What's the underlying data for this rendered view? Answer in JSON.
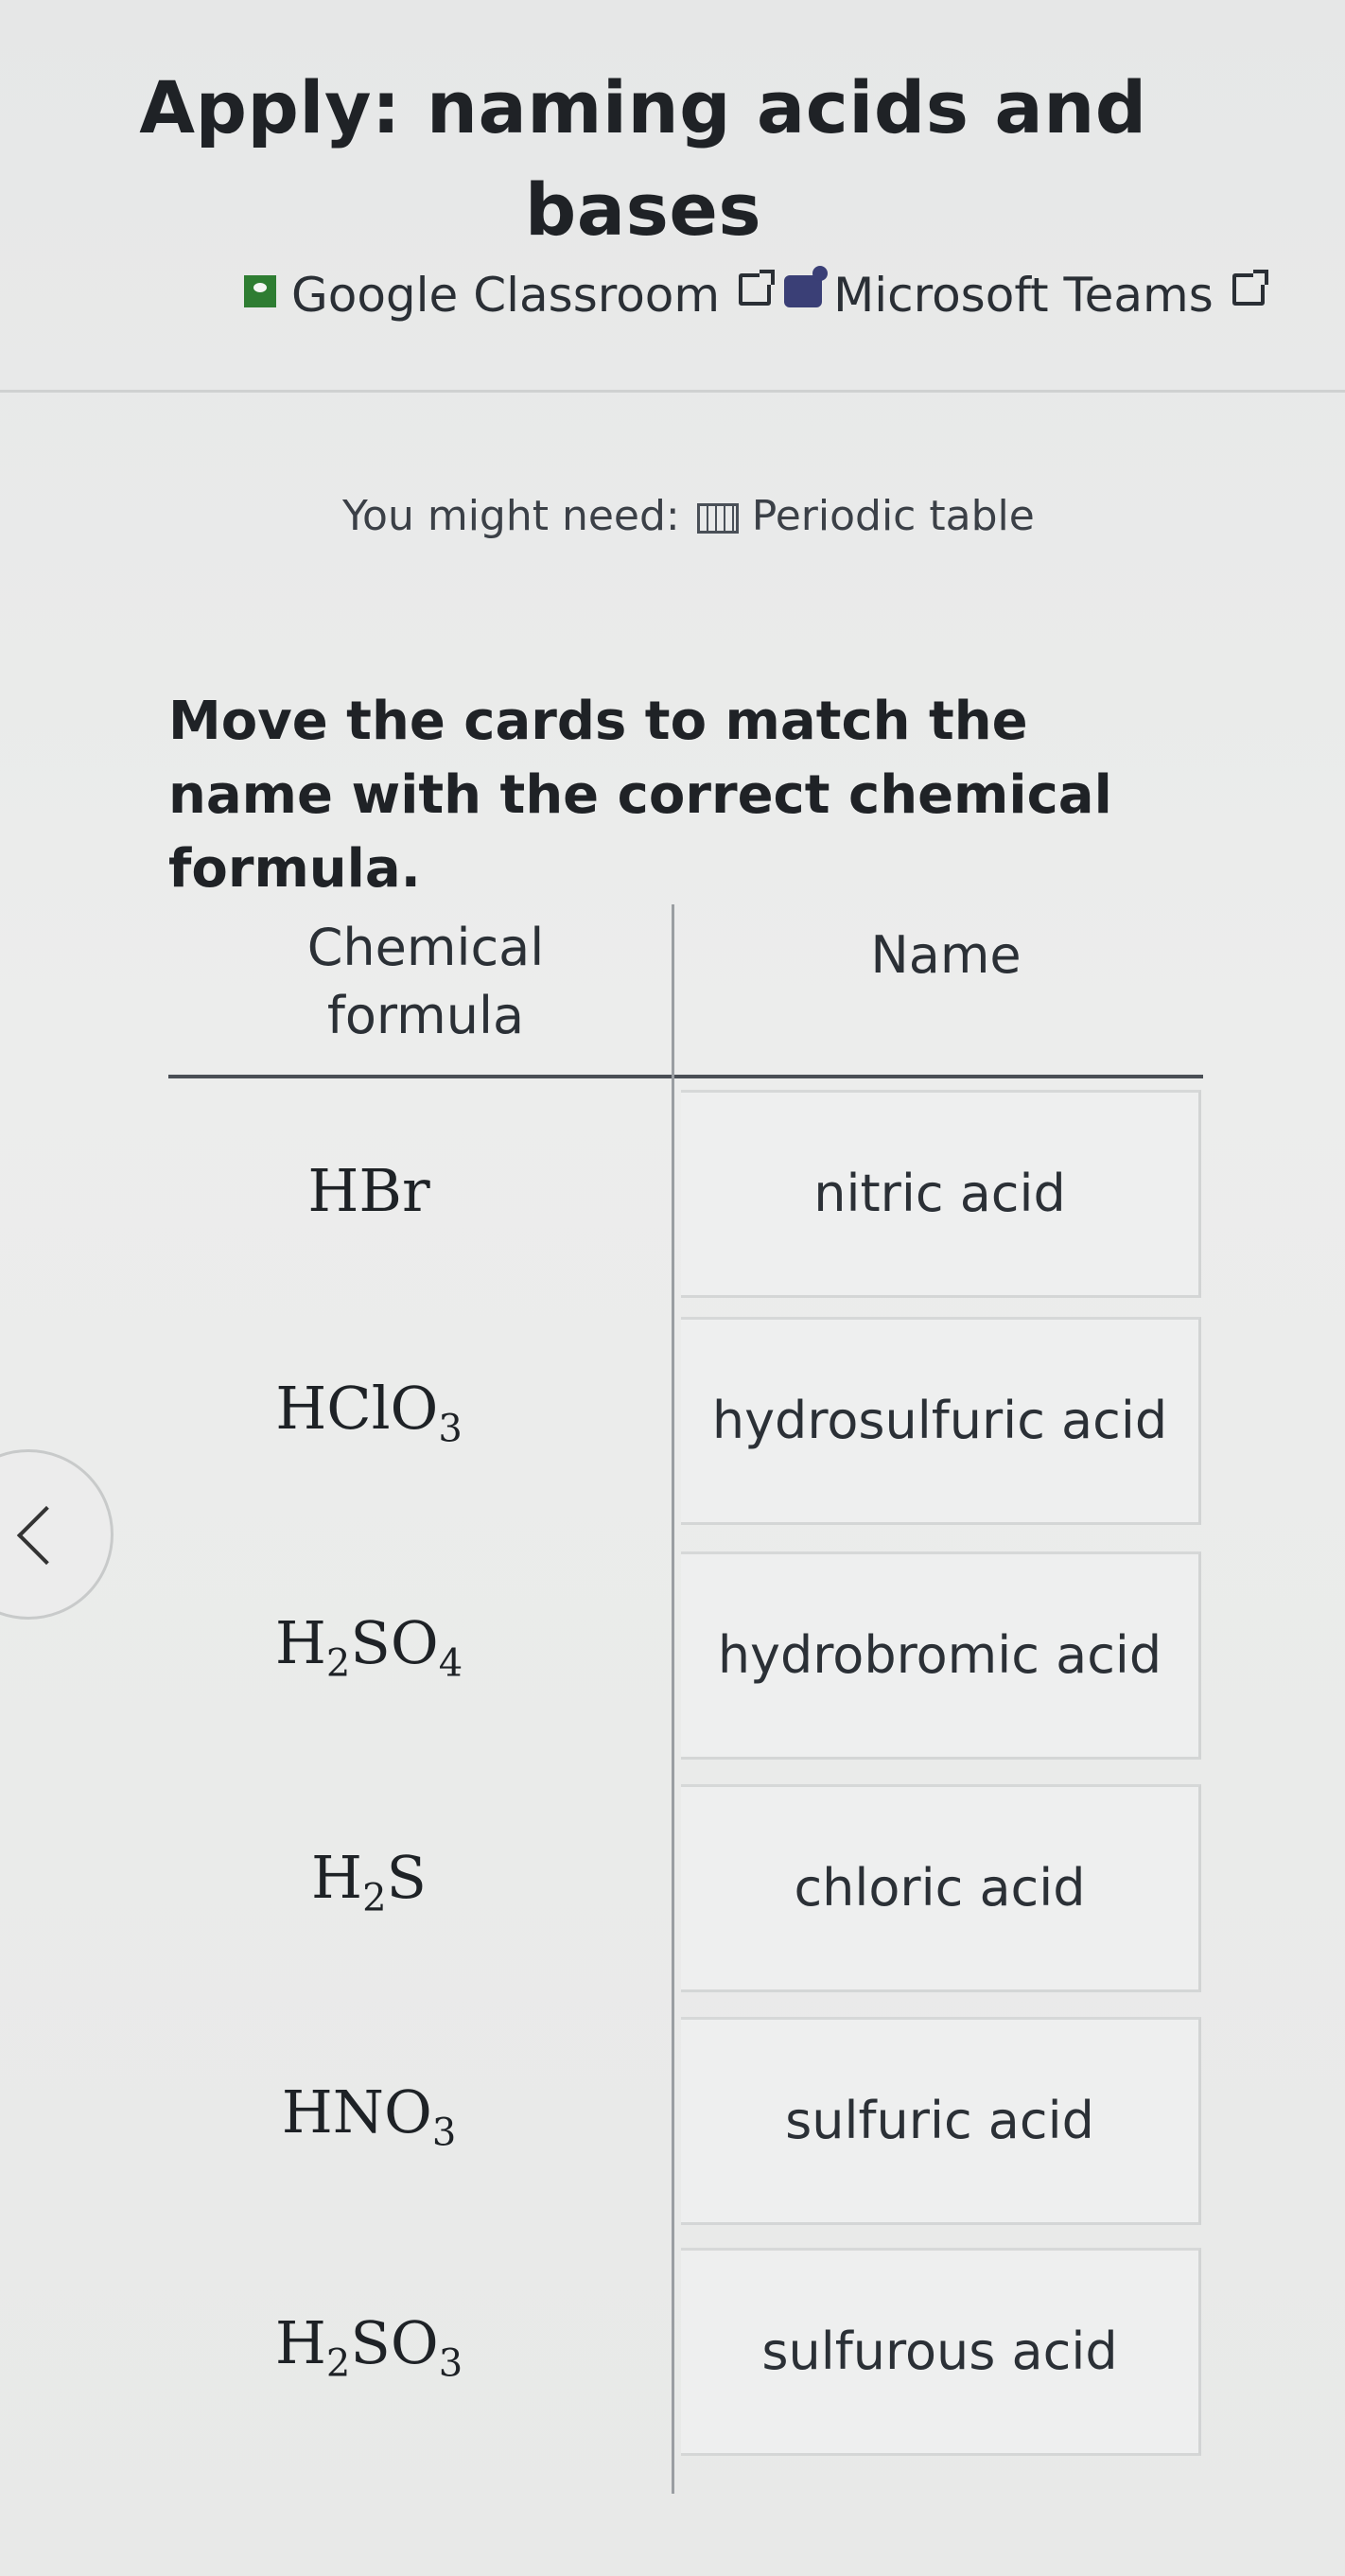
{
  "header": {
    "title": "Apply: naming acids and bases"
  },
  "share": {
    "google_classroom": "Google Classroom",
    "microsoft_teams": "Microsoft Teams"
  },
  "resources": {
    "prefix": "You might need:",
    "periodic_table": "Periodic table"
  },
  "instruction": "Move the cards to match the name with the correct chemical formula.",
  "table": {
    "headers": {
      "formula": "Chemical formula",
      "name": "Name"
    },
    "rows": [
      {
        "formula": {
          "base": "HBr",
          "parts": [
            {
              "t": "HBr"
            }
          ]
        },
        "card": "nitric acid"
      },
      {
        "formula": {
          "parts": [
            {
              "t": "HClO"
            },
            {
              "sub": "3"
            }
          ]
        },
        "card": "hydrosulfuric acid"
      },
      {
        "formula": {
          "parts": [
            {
              "t": "H"
            },
            {
              "sub": "2"
            },
            {
              "t": "SO"
            },
            {
              "sub": "4"
            }
          ]
        },
        "card": "hydrobromic acid"
      },
      {
        "formula": {
          "parts": [
            {
              "t": "H"
            },
            {
              "sub": "2"
            },
            {
              "t": "S"
            }
          ]
        },
        "card": "chloric acid"
      },
      {
        "formula": {
          "parts": [
            {
              "t": "HNO"
            },
            {
              "sub": "3"
            }
          ]
        },
        "card": "sulfuric acid"
      },
      {
        "formula": {
          "parts": [
            {
              "t": "H"
            },
            {
              "sub": "2"
            },
            {
              "t": "SO"
            },
            {
              "sub": "3"
            }
          ]
        },
        "card": "sulfurous acid"
      }
    ]
  },
  "icons": {
    "google_classroom": "google-classroom-icon",
    "external_link": "external-link-icon",
    "teams": "microsoft-teams-icon",
    "periodic_table": "periodic-table-icon",
    "back": "chevron-left-icon"
  }
}
